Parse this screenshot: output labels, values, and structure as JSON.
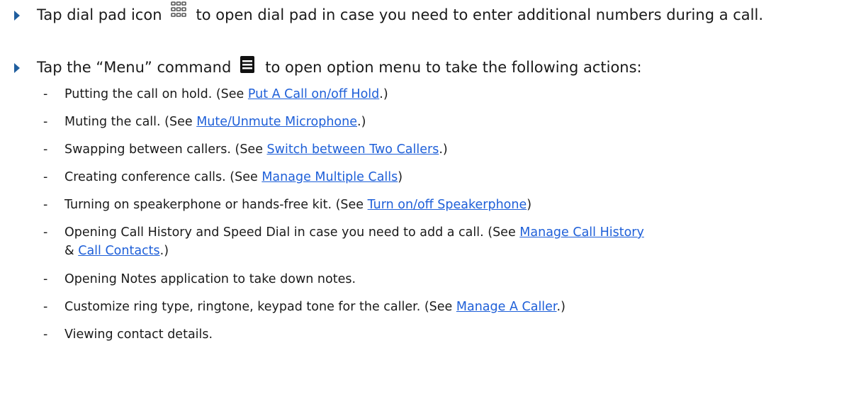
{
  "bullets": [
    {
      "before_icon": "Tap dial pad icon",
      "icon": "dialpad-icon",
      "after_icon": "to open dial pad in case you need to enter additional numbers during a call."
    },
    {
      "before_icon": "Tap the “Menu” command",
      "icon": "menu-icon",
      "after_icon": "to open option menu to take the following actions:"
    }
  ],
  "dash": "-",
  "actions": [
    {
      "text": "Putting the call on hold. (See ",
      "link": "Put A Call on/off Hold",
      "after": ".)"
    },
    {
      "text": "Muting the call. (See ",
      "link": "Mute/Unmute Microphone",
      "after": ".)"
    },
    {
      "text": "Swapping between callers. (See ",
      "link": "Switch between Two Callers",
      "after": ".)"
    },
    {
      "text": "Creating conference calls. (See ",
      "link": "Manage Multiple Calls",
      "after": ")"
    },
    {
      "text": "Turning on speakerphone or hands-free kit. (See ",
      "link": "Turn on/off Speakerphone",
      "after": ")"
    },
    {
      "text": "Opening Call History and Speed Dial in case you need to add a call. (See ",
      "link": "Manage Call History",
      "line2_before": "& ",
      "link2": "Call Contacts",
      "after": ".)"
    },
    {
      "text": "Opening Notes application to take down notes."
    },
    {
      "text": "Customize ring type, ringtone, keypad tone for the caller. (See ",
      "link": "Manage A Caller",
      "after": ".)"
    },
    {
      "text": "Viewing contact details."
    }
  ],
  "colors": {
    "bullet_arrow": "#1f5e9e",
    "link": "#1e5fd8",
    "text": "#1a1a1a"
  }
}
